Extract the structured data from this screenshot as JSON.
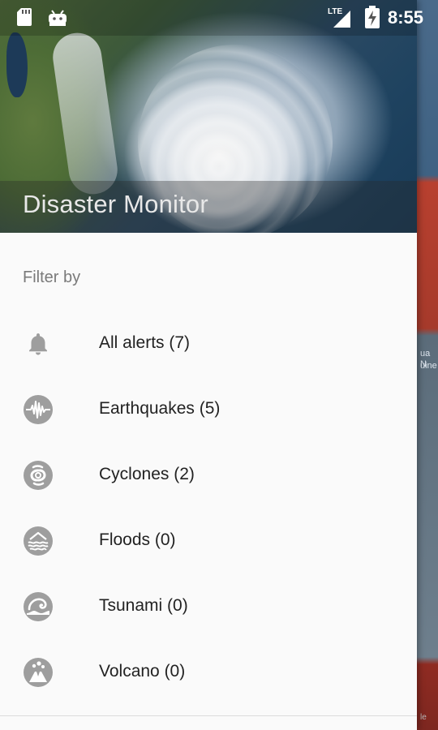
{
  "status_bar": {
    "time": "8:55",
    "network_label": "LTE",
    "icons": [
      "sd-card-icon",
      "android-icon",
      "lte-signal-icon",
      "battery-charging-icon"
    ]
  },
  "background": {
    "fragments": [
      "ua N",
      "uine",
      "le"
    ]
  },
  "drawer": {
    "header_title": "Disaster Monitor",
    "filter_title": "Filter by",
    "items": [
      {
        "label": "All alerts (7)",
        "icon": "bell-icon"
      },
      {
        "label": "Earthquakes (5)",
        "icon": "earthquake-icon"
      },
      {
        "label": "Cyclones (2)",
        "icon": "cyclone-icon"
      },
      {
        "label": "Floods (0)",
        "icon": "flood-icon"
      },
      {
        "label": "Tsunami (0)",
        "icon": "tsunami-icon"
      },
      {
        "label": "Volcano (0)",
        "icon": "volcano-icon"
      }
    ]
  },
  "colors": {
    "drawer_bg": "#fafafa",
    "icon_gray": "#9e9e9e",
    "text_primary": "#222222",
    "text_secondary": "#7a7a7a"
  }
}
